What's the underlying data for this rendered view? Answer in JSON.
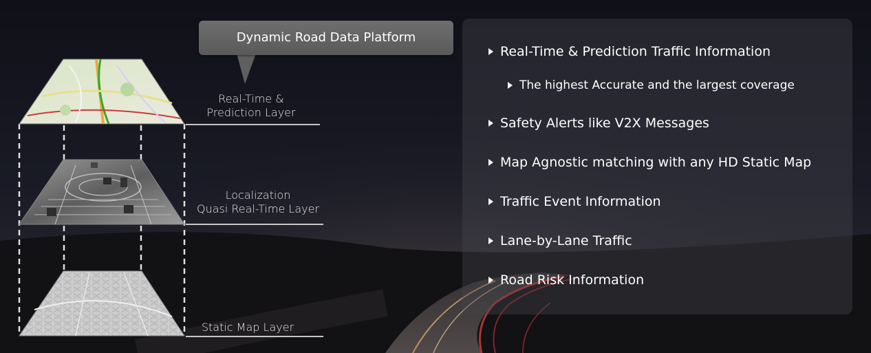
{
  "callout": {
    "title": "Dynamic Road Data Platform"
  },
  "layers": [
    {
      "label_line1": "Real-Time &",
      "label_line2": "Prediction Layer"
    },
    {
      "label_line1": "Localization",
      "label_line2": "Quasi Real-Time Layer"
    },
    {
      "label_line1": "Static Map Layer"
    }
  ],
  "features": [
    {
      "text": "Real-Time & Prediction Traffic Information",
      "level": 1
    },
    {
      "text": "The highest Accurate and the largest coverage",
      "level": 2
    },
    {
      "text": "Safety Alerts like V2X Messages",
      "level": 1
    },
    {
      "text": "Map Agnostic matching with any HD Static Map",
      "level": 1
    },
    {
      "text": "Traffic Event Information",
      "level": 1
    },
    {
      "text": "Lane-by-Lane Traffic",
      "level": 1
    },
    {
      "text": "Road Risk Information",
      "level": 1
    }
  ],
  "colors": {
    "background": "#14141c",
    "callout": "#666666",
    "panel": "#48485099",
    "road_light": "#c83a3a"
  },
  "icons": {
    "bullet": "triangle-right-icon"
  }
}
